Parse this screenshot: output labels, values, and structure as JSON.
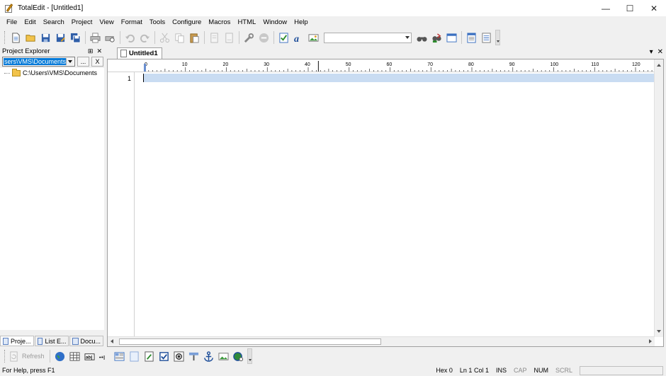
{
  "window": {
    "title": "TotalEdit - [Untitled1]",
    "minimize": "—",
    "maximize": "☐",
    "close": "✕"
  },
  "menu": [
    "File",
    "Edit",
    "Search",
    "Project",
    "View",
    "Format",
    "Tools",
    "Configure",
    "Macros",
    "HTML",
    "Window",
    "Help"
  ],
  "toolbar": {
    "icons": [
      "new-file-icon",
      "open-folder-icon",
      "save-icon",
      "save-as-icon",
      "save-all-icon",
      "print-icon",
      "print-preview-icon",
      "undo-icon",
      "redo-icon",
      "cut-icon",
      "copy-icon",
      "paste-icon",
      "page-icon",
      "page-copy-icon",
      "tools-icon",
      "stop-icon",
      "checklist-icon",
      "font-icon",
      "image-icon",
      "binoculars-icon",
      "replace-icon",
      "window-icon",
      "document-icon",
      "properties-icon"
    ],
    "search_combo": ""
  },
  "project_explorer": {
    "title": "Project Explorer",
    "pin": "⊞",
    "close": "✕",
    "path_value": "sers\\VMS\\Documents",
    "browse_label": "...",
    "clear_label": "X",
    "tree": [
      {
        "label": "C:\\Users\\VMS\\Documents"
      }
    ],
    "tabs": [
      {
        "label": "Proje...",
        "active": true
      },
      {
        "label": "List E...",
        "active": false
      },
      {
        "label": "Docu...",
        "active": false
      }
    ]
  },
  "editor": {
    "tab": "Untitled1",
    "dropdown": "▾",
    "close": "✕",
    "ruler_labels": [
      "0",
      "10",
      "20",
      "30",
      "40",
      "50",
      "60",
      "70",
      "80",
      "90",
      "100",
      "110",
      "120"
    ],
    "line_numbers": [
      "1"
    ]
  },
  "bottom_toolbar": {
    "refresh_label": "Refresh",
    "icons": [
      "globe-icon",
      "table-icon",
      "text-field-icon",
      "abbr-icon",
      "layout-icon",
      "frame-icon",
      "edit-icon",
      "checkbox-icon",
      "radio-icon",
      "heading-icon",
      "anchor-icon",
      "image-icon",
      "web-icon"
    ]
  },
  "status": {
    "help": "For Help, press F1",
    "hex": "Hex  0",
    "position": "Ln  1 Col  1",
    "ins": "INS",
    "cap": "CAP",
    "num": "NUM",
    "scrl": "SCRL"
  }
}
